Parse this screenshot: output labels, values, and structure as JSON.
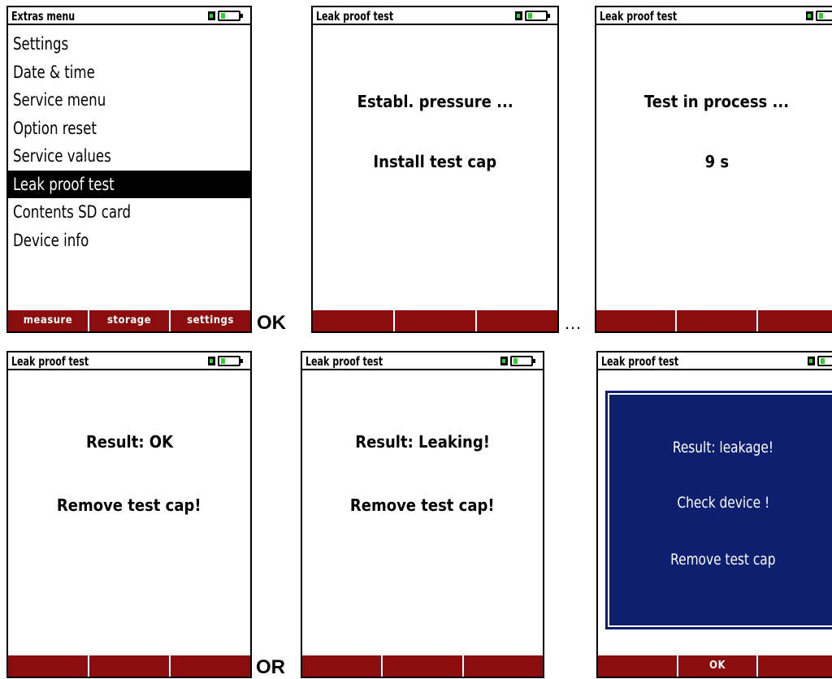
{
  "screens": {
    "extras": {
      "title": "Extras menu",
      "items": [
        "Settings",
        "Date & time",
        "Service menu",
        "Option reset",
        "Service values",
        "Leak proof test",
        "Contents SD card",
        "Device info"
      ],
      "selected_index": 5,
      "softkeys": [
        "measure",
        "storage",
        "settings"
      ]
    },
    "establish": {
      "title": "Leak proof test",
      "line1": "Establ. pressure ...",
      "line2": "Install test cap"
    },
    "testing": {
      "title": "Leak proof test",
      "line1": "Test in process ...",
      "line2": "9 s"
    },
    "result_ok": {
      "title": "Leak proof test",
      "line1": "Result: OK",
      "line2": "Remove test cap!"
    },
    "result_leaking": {
      "title": "Leak proof test",
      "line1": "Result: Leaking!",
      "line2": "Remove test cap!"
    },
    "result_dialog": {
      "title": "Leak proof test",
      "line1": "Result: leakage!",
      "line2": "Check device !",
      "line3": "Remove test cap",
      "softkey_ok": "OK"
    }
  },
  "connectors": {
    "ok": "OK",
    "ellipsis": "…",
    "or": "OR"
  },
  "colors": {
    "softkey_bar": "#8b0d0d",
    "dialog_bg": "#0d1f6e",
    "battery_green": "#2fd12f"
  },
  "icons": [
    "battery-icon",
    "plug-icon"
  ]
}
